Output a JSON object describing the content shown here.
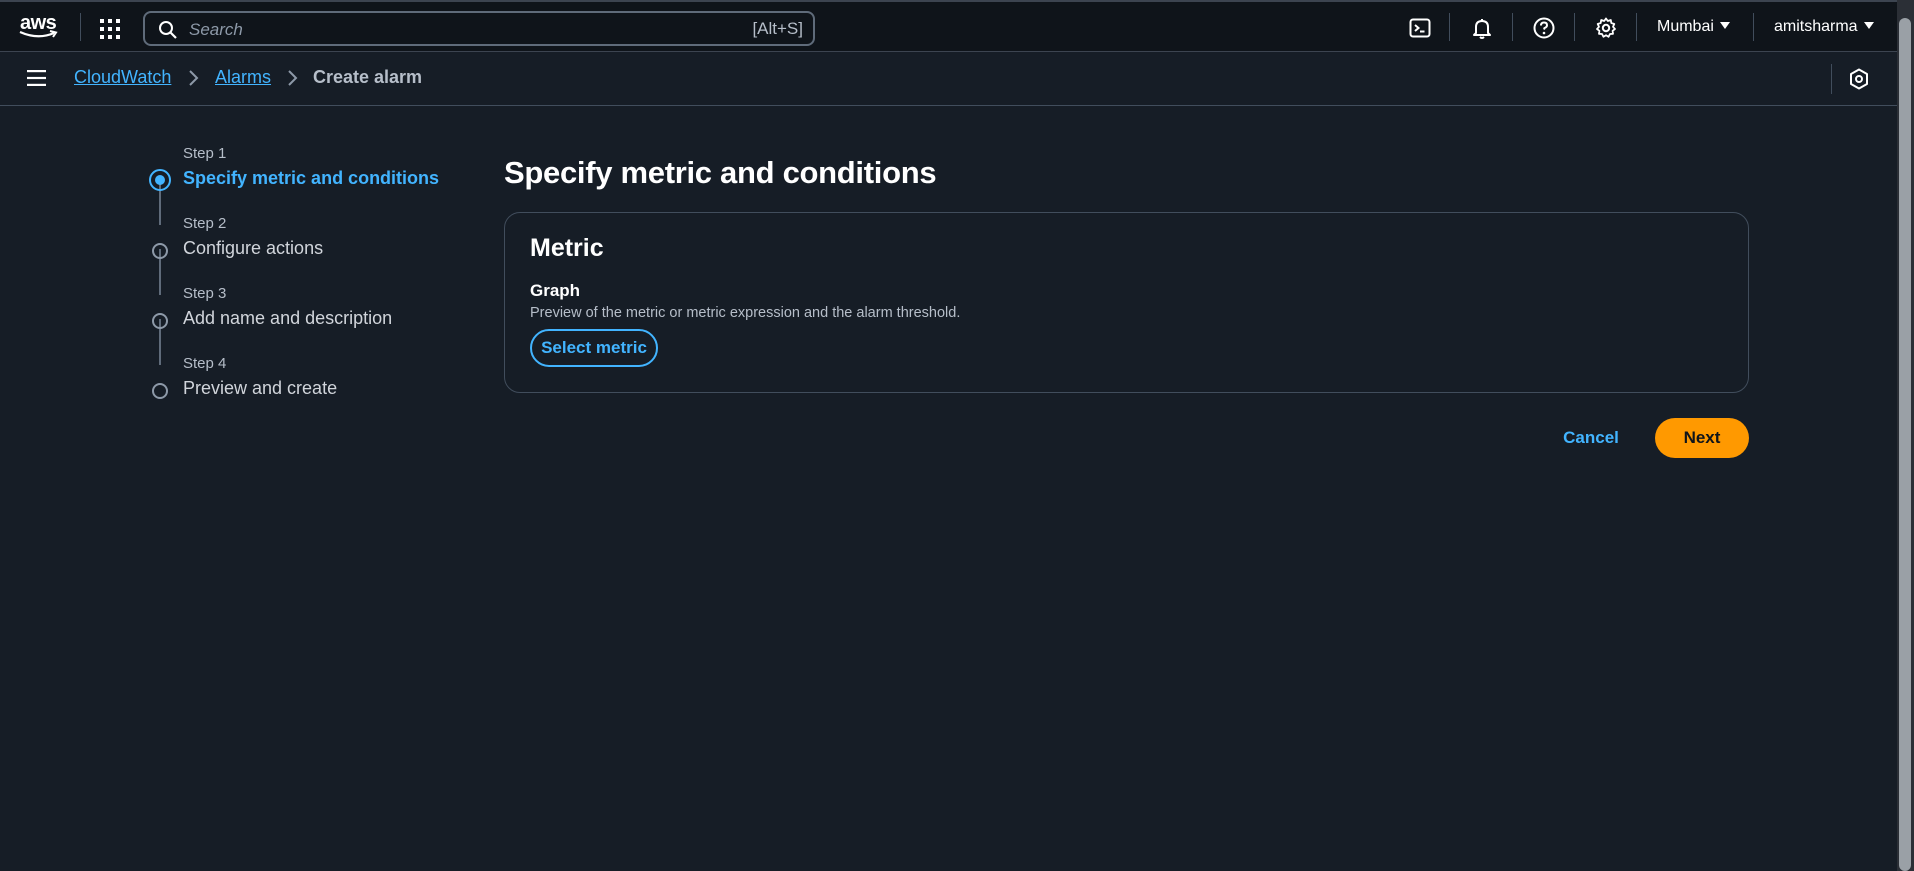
{
  "topnav": {
    "logo_text": "aws",
    "search": {
      "placeholder": "Search",
      "value": "",
      "shortcut": "[Alt+S]"
    },
    "icons": [
      "cloudshell-icon",
      "bell-icon",
      "help-icon",
      "gear-icon"
    ],
    "region": "Mumbai",
    "user": "amitsharma"
  },
  "breadcrumb": {
    "items": [
      {
        "label": "CloudWatch",
        "link": true
      },
      {
        "label": "Alarms",
        "link": true
      },
      {
        "label": "Create alarm",
        "link": false
      }
    ]
  },
  "steps": [
    {
      "number": "Step 1",
      "title": "Specify metric and conditions",
      "active": true
    },
    {
      "number": "Step 2",
      "title": "Configure actions",
      "active": false
    },
    {
      "number": "Step 3",
      "title": "Add name and description",
      "active": false
    },
    {
      "number": "Step 4",
      "title": "Preview and create",
      "active": false
    }
  ],
  "main": {
    "title": "Specify metric and conditions",
    "panel": {
      "title": "Metric",
      "field_label": "Graph",
      "field_description": "Preview of the metric or metric expression and the alarm threshold.",
      "select_button": "Select metric"
    },
    "cancel_label": "Cancel",
    "next_label": "Next"
  },
  "colors": {
    "background": "#161d26",
    "topbar": "#0f141a",
    "link": "#42b4ff",
    "primary": "#ff9900",
    "border": "#414d5c"
  }
}
